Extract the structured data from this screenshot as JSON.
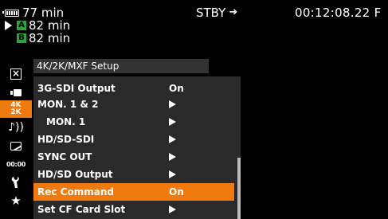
{
  "status": {
    "battery_time": "77 min",
    "slot_a_label": "A",
    "slot_a_time": "82 min",
    "slot_b_label": "B",
    "slot_b_time": "82 min",
    "rec_state": "STBY",
    "rec_state_arrow": "➜",
    "timecode": "00:12:08.22 F"
  },
  "menu": {
    "title": "4K/2K/MXF Setup",
    "items": [
      {
        "label": "3G-SDI Output",
        "value": "On"
      },
      {
        "label": "MON. 1 & 2"
      },
      {
        "label": "MON. 1"
      },
      {
        "label": "HD/SD-SDI"
      },
      {
        "label": "SYNC OUT"
      },
      {
        "label": "HD/SD Output"
      },
      {
        "label": "Rec Command",
        "value": "On"
      },
      {
        "label": "Set CF Card Slot"
      }
    ],
    "selected_index": 6
  },
  "sidebar": {
    "tabs": [
      {
        "icon": "close-x-icon"
      },
      {
        "icon": "camera-icon"
      },
      {
        "icon": "4k-2k-icon",
        "text_top": "4K",
        "text_bottom": "2K"
      },
      {
        "icon": "audio-icon",
        "text": "♪))"
      },
      {
        "icon": "display-icon"
      },
      {
        "icon": "timecode-icon",
        "text": "00:00"
      },
      {
        "icon": "wrench-icon"
      },
      {
        "icon": "star-icon",
        "text": "★"
      }
    ],
    "active_index": 2
  },
  "colors": {
    "accent": "#f07a0e",
    "slot_green": "#2aa43c",
    "panel": "#2a2a2a",
    "title_bar": "#333333"
  }
}
